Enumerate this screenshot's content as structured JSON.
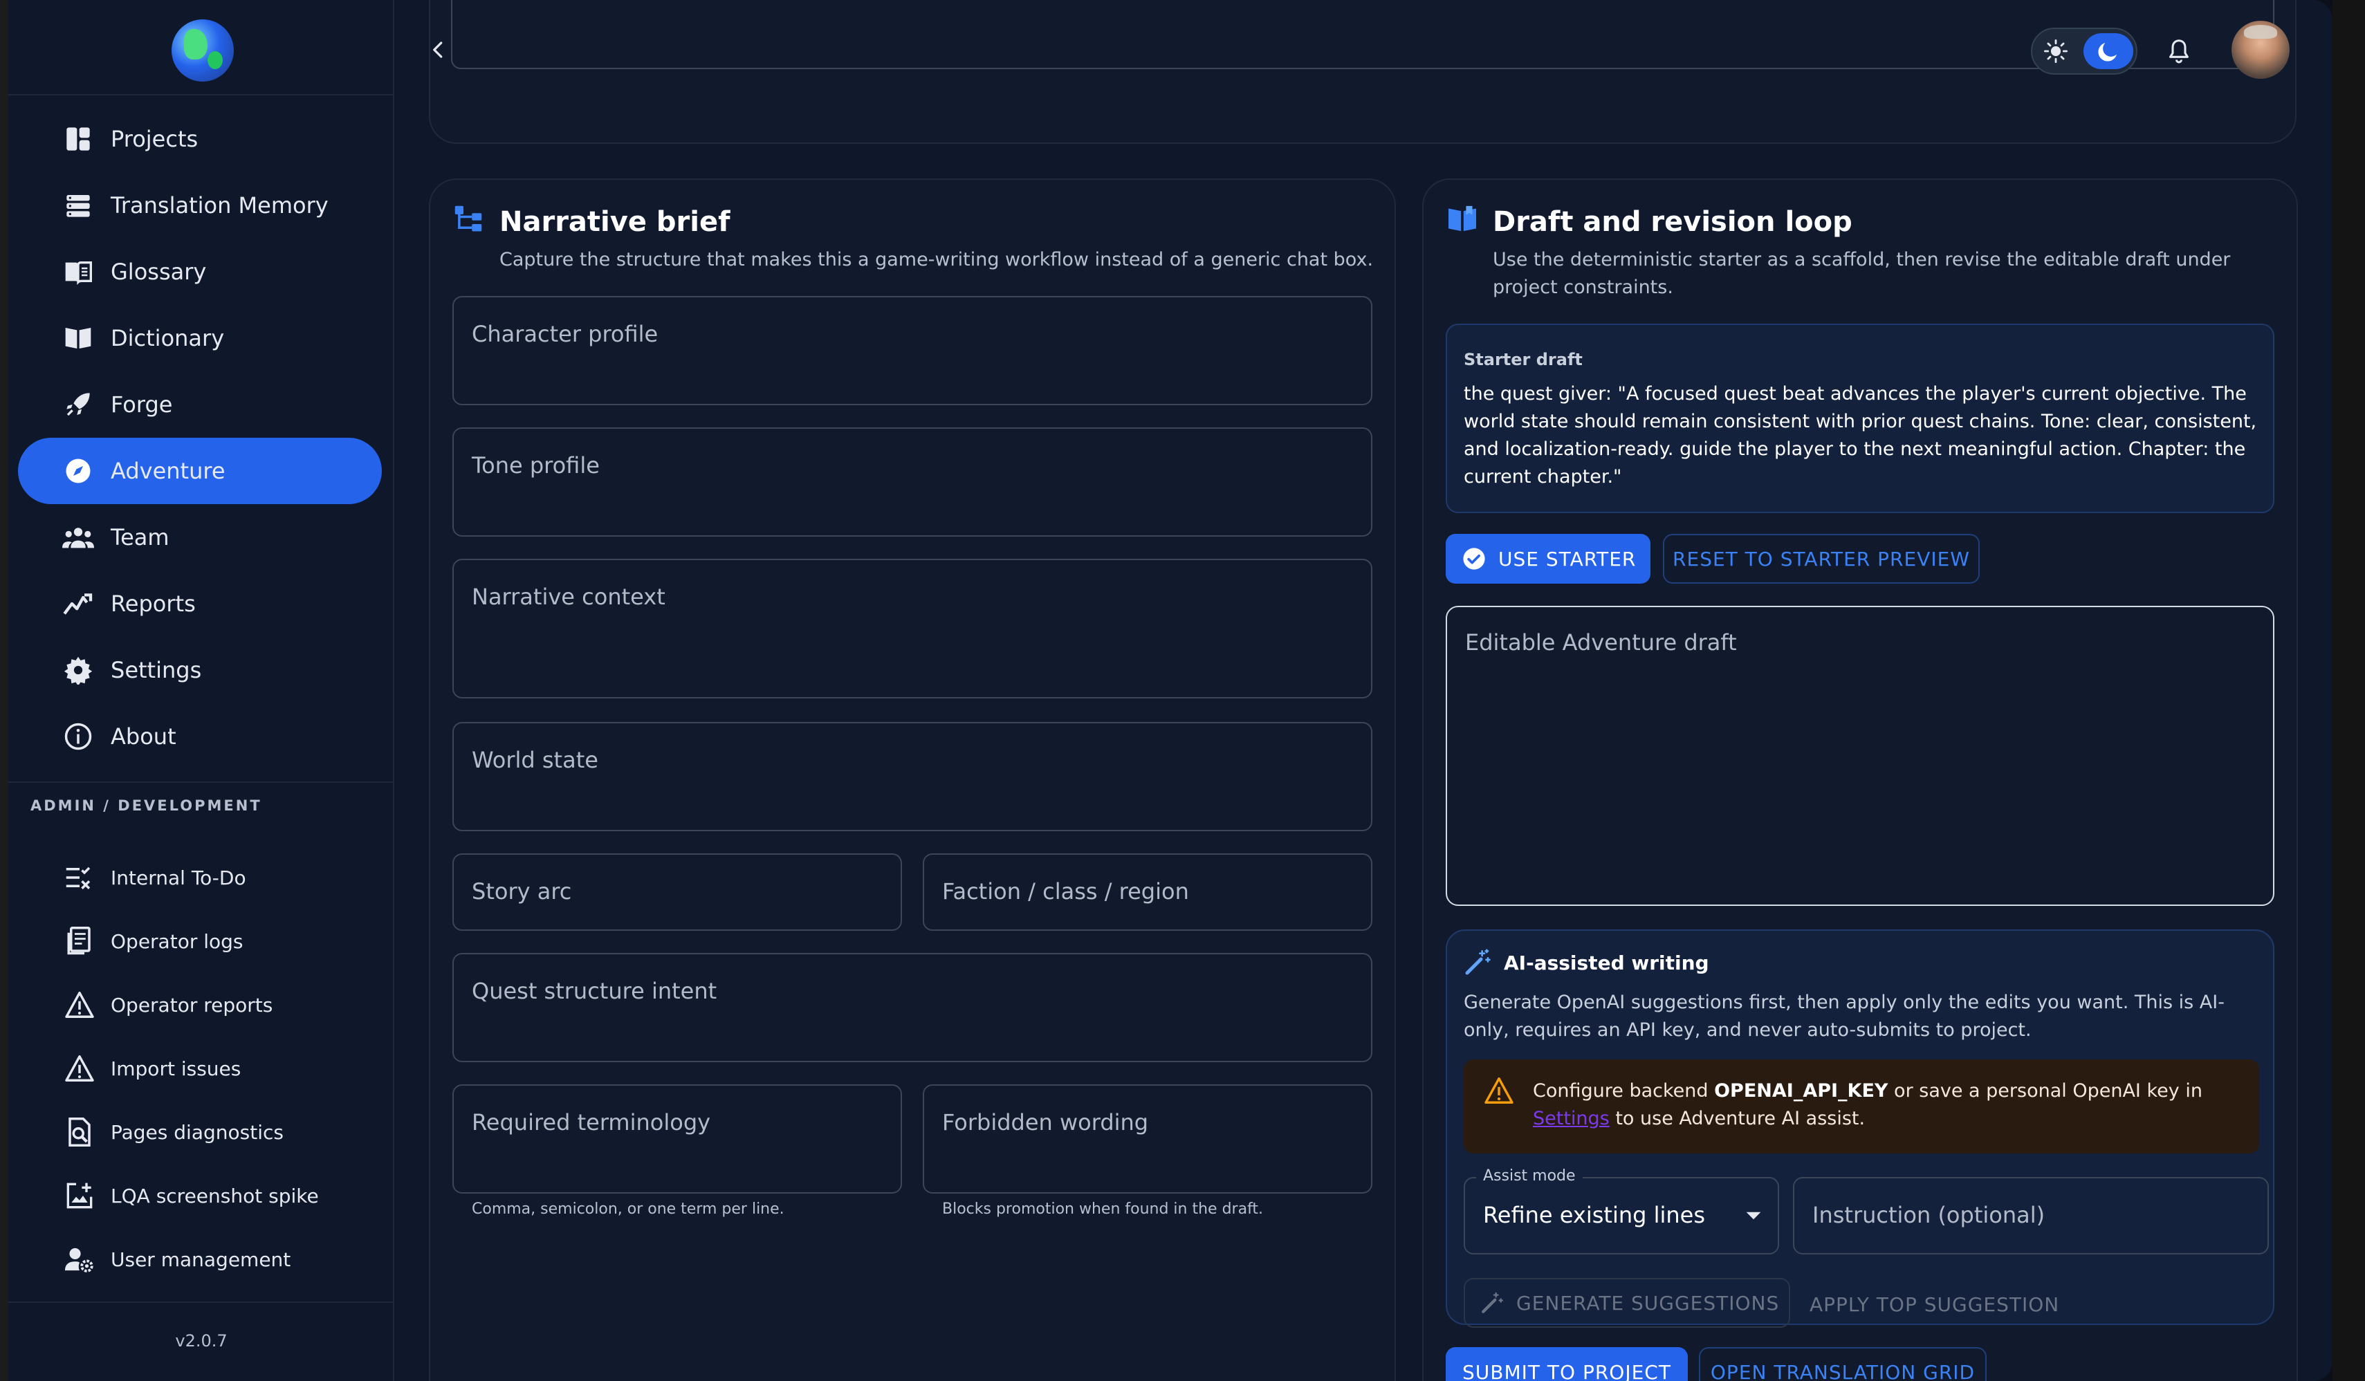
{
  "sidebar": {
    "nav": [
      {
        "label": "Projects",
        "icon": "projects-icon"
      },
      {
        "label": "Translation Memory",
        "icon": "database-icon"
      },
      {
        "label": "Glossary",
        "icon": "glossary-icon"
      },
      {
        "label": "Dictionary",
        "icon": "book-open-icon"
      },
      {
        "label": "Forge",
        "icon": "rocket-icon"
      },
      {
        "label": "Adventure",
        "icon": "compass-icon",
        "active": true
      },
      {
        "label": "Team",
        "icon": "team-icon"
      },
      {
        "label": "Reports",
        "icon": "trend-icon"
      },
      {
        "label": "Settings",
        "icon": "gear-icon"
      },
      {
        "label": "About",
        "icon": "info-icon"
      }
    ],
    "section_label": "ADMIN / DEVELOPMENT",
    "admin": [
      {
        "label": "Internal To-Do",
        "icon": "checklist-icon"
      },
      {
        "label": "Operator logs",
        "icon": "log-icon"
      },
      {
        "label": "Operator reports",
        "icon": "warning-icon"
      },
      {
        "label": "Import issues",
        "icon": "warning-icon"
      },
      {
        "label": "Pages diagnostics",
        "icon": "page-search-icon"
      },
      {
        "label": "LQA screenshot spike",
        "icon": "screenshot-icon"
      },
      {
        "label": "User management",
        "icon": "user-gear-icon"
      }
    ],
    "version": "v2.0.7"
  },
  "narrative": {
    "title": "Narrative brief",
    "subtitle": "Capture the structure that makes this a game-writing workflow instead of a generic chat box.",
    "fields": {
      "character": "Character profile",
      "tone": "Tone profile",
      "context": "Narrative context",
      "world": "World state",
      "story_arc": "Story arc",
      "faction": "Faction / class / region",
      "quest": "Quest structure intent",
      "required": "Required terminology",
      "forbidden": "Forbidden wording"
    },
    "helpers": {
      "required": "Comma, semicolon, or one term per line.",
      "forbidden": "Blocks promotion when found in the draft."
    }
  },
  "draft": {
    "title": "Draft and revision loop",
    "subtitle": "Use the deterministic starter as a scaffold, then revise the editable draft under project constraints.",
    "starter_title": "Starter draft",
    "starter_text": "the quest giver: \"A focused quest beat advances the player's current objective. The world state should remain consistent with prior quest chains. Tone: clear, consistent, and localization-ready. guide the player to the next meaningful action. Chapter: the current chapter.\"",
    "use_starter": "USE STARTER",
    "reset": "RESET TO STARTER PREVIEW",
    "editable_placeholder": "Editable Adventure draft",
    "ai": {
      "title": "AI-assisted writing",
      "desc": "Generate OpenAI suggestions first, then apply only the edits you want. This is AI-only, requires an API key, and never auto-submits to project.",
      "warn_pre": "Configure backend ",
      "warn_key": "OPENAI_API_KEY",
      "warn_mid": " or save a personal OpenAI key in ",
      "warn_link": "Settings",
      "warn_post": " to use Adventure AI assist.",
      "assist_label": "Assist mode",
      "assist_value": "Refine existing lines",
      "instruction_placeholder": "Instruction (optional)",
      "generate": "GENERATE SUGGESTIONS",
      "apply": "APPLY TOP SUGGESTION"
    },
    "submit": "SUBMIT TO PROJECT",
    "open_grid": "OPEN TRANSLATION GRID"
  },
  "colors": {
    "accent": "#2563eb",
    "background": "#0f172a",
    "panel": "#111a2c",
    "warning": "#f59e0b"
  }
}
